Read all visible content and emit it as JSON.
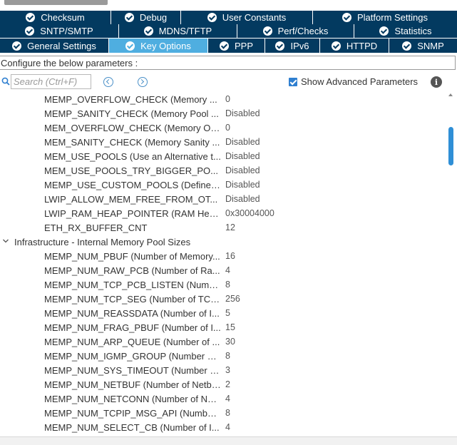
{
  "tabs_row1": [
    {
      "label": "Checksum",
      "active": false
    },
    {
      "label": "Debug",
      "active": false
    },
    {
      "label": "User Constants",
      "active": false
    },
    {
      "label": "Platform Settings",
      "active": false
    }
  ],
  "tabs_row2": [
    {
      "label": "SNTP/SMTP",
      "active": false
    },
    {
      "label": "MDNS/TFTP",
      "active": false
    },
    {
      "label": "Perf/Checks",
      "active": false
    },
    {
      "label": "Statistics",
      "active": false
    }
  ],
  "tabs_row3": [
    {
      "label": "General Settings",
      "active": false
    },
    {
      "label": "Key Options",
      "active": true
    },
    {
      "label": "PPP",
      "active": false
    },
    {
      "label": "IPv6",
      "active": false
    },
    {
      "label": "HTTPD",
      "active": false
    },
    {
      "label": "SNMP",
      "active": false
    }
  ],
  "config_label": "Configure the below parameters :",
  "search": {
    "placeholder": "Search (Ctrl+F)",
    "value": ""
  },
  "advanced": {
    "label": "Show Advanced Parameters",
    "checked": true
  },
  "parameters": [
    {
      "name": "MEMP_OVERFLOW_CHECK (Memory ...",
      "value": "0"
    },
    {
      "name": "MEMP_SANITY_CHECK (Memory Pool ...",
      "value": "Disabled"
    },
    {
      "name": "MEM_OVERFLOW_CHECK (Memory Ov...",
      "value": "0"
    },
    {
      "name": "MEM_SANITY_CHECK (Memory Sanity ...",
      "value": "Disabled"
    },
    {
      "name": "MEM_USE_POOLS (Use an Alternative t...",
      "value": "Disabled"
    },
    {
      "name": "MEM_USE_POOLS_TRY_BIGGER_PO...",
      "value": "Disabled"
    },
    {
      "name": "MEMP_USE_CUSTOM_POOLS (Define ...",
      "value": "Disabled"
    },
    {
      "name": "LWIP_ALLOW_MEM_FREE_FROM_OT...",
      "value": "Disabled"
    },
    {
      "name": "LWIP_RAM_HEAP_POINTER (RAM Hea...",
      "value": "0x30004000"
    },
    {
      "name": "ETH_RX_BUFFER_CNT",
      "value": "12"
    },
    {
      "group": "Infrastructure - Internal Memory Pool Sizes"
    },
    {
      "name": "MEMP_NUM_PBUF (Number of Memory...",
      "value": "16"
    },
    {
      "name": "MEMP_NUM_RAW_PCB (Number of Ra...",
      "value": "4"
    },
    {
      "name": "MEMP_NUM_TCP_PCB_LISTEN (Numb...",
      "value": "8"
    },
    {
      "name": "MEMP_NUM_TCP_SEG (Number of TCP...",
      "value": "256"
    },
    {
      "name": "MEMP_NUM_REASSDATA (Number of I...",
      "value": "5"
    },
    {
      "name": "MEMP_NUM_FRAG_PBUF (Number of I...",
      "value": "15"
    },
    {
      "name": "MEMP_NUM_ARP_QUEUE (Number of ...",
      "value": "30"
    },
    {
      "name": "MEMP_NUM_IGMP_GROUP (Number of...",
      "value": "8"
    },
    {
      "name": "MEMP_NUM_SYS_TIMEOUT (Number o...",
      "value": "3"
    },
    {
      "name": "MEMP_NUM_NETBUF (Number of Netbu...",
      "value": "2"
    },
    {
      "name": "MEMP_NUM_NETCONN (Number of Net...",
      "value": "4"
    },
    {
      "name": "MEMP_NUM_TCPIP_MSG_API (Number...",
      "value": "8"
    },
    {
      "name": "MEMP_NUM_SELECT_CB (Number of I...",
      "value": "4"
    }
  ],
  "icons": {
    "tab_check": "check-circle-icon",
    "search": "search-icon",
    "prev": "chevron-left-icon",
    "next": "chevron-right-icon",
    "info": "info-icon",
    "group_toggle": "chevron-down-icon"
  },
  "colors": {
    "tab_bg": "#033a60",
    "tab_active_bg": "#4faee0",
    "accent": "#2f7fd0",
    "scroll_thumb": "#2f8fd6"
  }
}
